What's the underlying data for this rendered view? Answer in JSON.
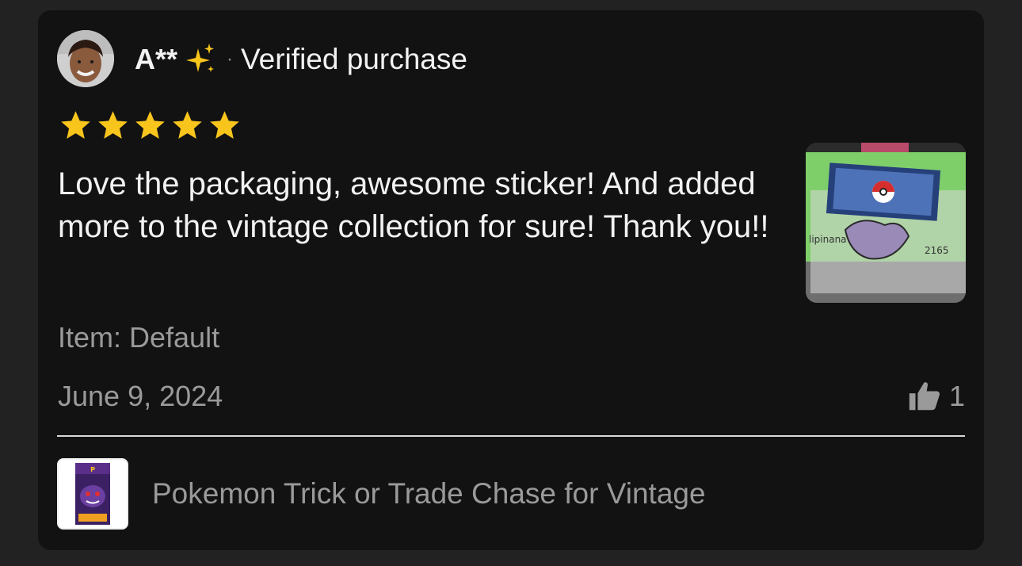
{
  "review": {
    "reviewer_name": "A**",
    "name_emoji": "sparkles-icon",
    "separator": "·",
    "verified_label": "Verified purchase",
    "rating": 5,
    "rating_max": 5,
    "text": "Love the packaging, awesome sticker! And added more to the vintage collection for sure! Thank you!!",
    "item": "Item: Default",
    "date": "June 9, 2024",
    "helpful_count": "1"
  },
  "product": {
    "title": "Pokemon Trick or Trade Chase for Vintage"
  },
  "colors": {
    "card_bg": "#121212",
    "page_bg": "#222222",
    "star": "#f8c51c",
    "text_primary": "#f2f2f2",
    "text_secondary": "#9a9a9a"
  }
}
